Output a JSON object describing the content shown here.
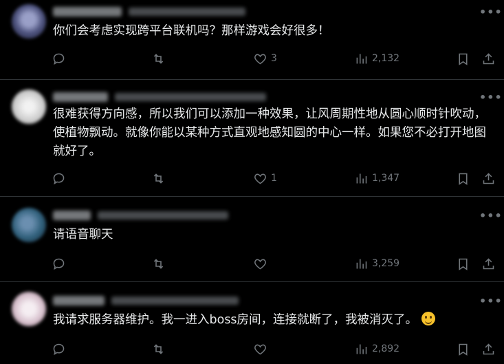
{
  "replies": [
    {
      "text": "你们会考虑实现跨平台联机吗？那样游戏会好很多！",
      "likes": "3",
      "views": "2,132",
      "retweets": "",
      "avatar_color": "#4a4f7a"
    },
    {
      "text": "很难获得方向感，所以我们可以添加一种效果，让风周期性地从圆心顺时针吹动，使植物飘动。就像你能以某种方式直观地感知圆的中心一样。如果您不必打开地图就好了。",
      "likes": "1",
      "views": "1,347",
      "retweets": "",
      "avatar_color": "#d8d8d8"
    },
    {
      "text": "请语音聊天",
      "likes": "",
      "views": "3,259",
      "retweets": "",
      "avatar_color": "#2f5f7a"
    },
    {
      "text": "我请求服务器维护。我一进入boss房间，连接就断了，我被消灭了。",
      "likes": "",
      "views": "2,892",
      "retweets": "",
      "avatar_color": "#d9c3cf",
      "emoji": "face-with-tear-icon"
    }
  ],
  "icons": {
    "reply": "reply-icon",
    "retweet": "retweet-icon",
    "like": "heart-icon",
    "views": "views-icon",
    "bookmark": "bookmark-icon",
    "share": "share-icon",
    "more": "more-icon"
  },
  "colors": {
    "background": "#000000",
    "text": "#e7e9ea",
    "muted": "#71767b",
    "divider": "#2f3336"
  }
}
